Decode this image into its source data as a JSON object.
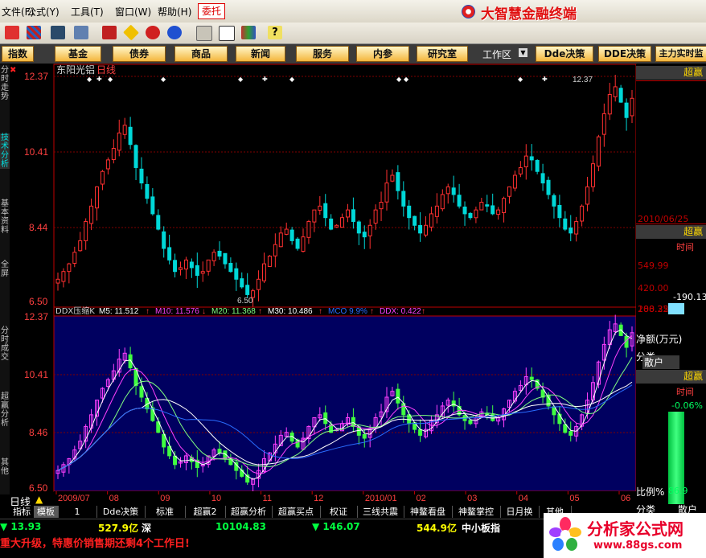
{
  "app": {
    "title": "大智慧金融终端"
  },
  "menu": {
    "items": [
      {
        "label": "文件(F)"
      },
      {
        "label": "公式(Y)"
      },
      {
        "label": "工具(T)"
      },
      {
        "label": "窗口(W)"
      },
      {
        "label": "帮助(H)"
      }
    ],
    "entrust": "委托"
  },
  "toolbar": {
    "icons": [
      "quote-icon",
      "draw-icon",
      "binoculars-icon",
      "tools-icon",
      "flag-icon",
      "diamond-icon",
      "speaker-icon",
      "globe-icon",
      "calculator-icon",
      "window-icon",
      "books-icon",
      "help-icon"
    ]
  },
  "nav": {
    "buttons": [
      "指数",
      "基金",
      "债券",
      "商品",
      "新闻",
      "服务",
      "内参",
      "研究室"
    ],
    "workarea": "工作区",
    "dde_buttons": [
      "Dde决策",
      "DDE决策"
    ],
    "main_monitor": "主力实时监"
  },
  "left_tabs": [
    "分时走势",
    "技术分析",
    "基本资料",
    "全屏",
    "分时成交",
    "超赢分析",
    "其他"
  ],
  "price_chart": {
    "stock_name": "东阳光铝",
    "period": "日线",
    "y_labels": [
      "12.37",
      "10.41",
      "8.44",
      "6.50"
    ],
    "low_annotation": "6.50",
    "high_annotation": "12.37"
  },
  "ddx_chart": {
    "title": "DDX压缩K",
    "indicators": [
      {
        "label": "M5: 11.512",
        "arrow": "↑",
        "color": "#ffffff"
      },
      {
        "label": "M10: 11.576",
        "arrow": "↓",
        "color": "#ff40ff"
      },
      {
        "label": "M20: 11.368",
        "arrow": "↑",
        "color": "#80ff80"
      },
      {
        "label": "M30: 10.486",
        "arrow": "↑",
        "color": "#ffffff"
      },
      {
        "label": "MCO  9.9%",
        "arrow": "↑",
        "color": "#2a6cff"
      },
      {
        "label": "DDX: 0.422",
        "arrow": "↑",
        "color": "#ff40ff"
      }
    ],
    "y_labels": [
      "12.37",
      "10.41",
      "8.46",
      "6.50"
    ]
  },
  "chart_data": {
    "type": "candlestick",
    "title": "东阳光铝 日线",
    "x_labels": [
      "2009/07",
      "08",
      "09",
      "10",
      "11",
      "12",
      "2010/01",
      "02",
      "03",
      "04",
      "05",
      "06"
    ],
    "ylim": [
      6.5,
      12.37
    ],
    "y_ticks": [
      12.37,
      10.41,
      8.44,
      6.5
    ],
    "close_series": [
      7.1,
      7.3,
      7.5,
      7.8,
      8.1,
      8.6,
      9.0,
      9.5,
      9.9,
      10.2,
      10.5,
      10.9,
      11.1,
      10.6,
      10.0,
      9.6,
      9.2,
      8.8,
      8.4,
      7.9,
      7.6,
      7.3,
      7.4,
      7.6,
      7.4,
      7.2,
      7.3,
      7.6,
      7.8,
      7.7,
      7.5,
      7.3,
      7.1,
      6.9,
      6.7,
      6.8,
      7.1,
      7.5,
      7.7,
      8.0,
      8.3,
      8.4,
      8.1,
      7.9,
      8.2,
      8.6,
      8.9,
      9.0,
      8.7,
      8.4,
      8.5,
      8.7,
      8.9,
      8.6,
      8.3,
      8.2,
      8.5,
      8.9,
      9.1,
      9.6,
      9.8,
      9.4,
      9.0,
      8.7,
      8.5,
      8.3,
      8.5,
      8.8,
      9.0,
      9.3,
      9.5,
      9.3,
      9.0,
      8.8,
      8.7,
      8.9,
      9.1,
      9.0,
      8.8,
      8.9,
      9.2,
      9.5,
      9.8,
      10.0,
      10.3,
      10.2,
      9.9,
      9.6,
      9.3,
      9.0,
      8.7,
      8.4,
      8.3,
      8.6,
      9.0,
      9.5,
      10.1,
      10.8,
      11.4,
      11.9,
      12.1,
      11.7,
      11.3,
      11.8
    ]
  },
  "right_panel": {
    "header1": "超赢",
    "date": "2010/06/25",
    "header2": "超赢",
    "time_label1": "时间",
    "scale": [
      "549.99",
      "420.00",
      "280.25"
    ],
    "value_neg": "-190.13",
    "value_pos": "108.32",
    "net_amount": "净额(万元)",
    "classify1": "分类",
    "retail": "散户",
    "header3": "超赢",
    "time_label2": "时间",
    "percent": "-0.06%",
    "ratio_label": "比例%",
    "ratio_value": "86.9",
    "classify2": "分类",
    "retail2": "散户"
  },
  "bottom_tabs": [
    "指标",
    "模板",
    "1",
    "Dde决策",
    "标准",
    "超赢2",
    "超赢分析",
    "超赢买点",
    "权证",
    "三线共震",
    "神鳌看盘",
    "神鳌掌控",
    "日月换",
    "其他"
  ],
  "period_label": "日线",
  "status": {
    "idx1": "13.93",
    "vol1": "527.9亿",
    "mkt": "深",
    "idx2": "10104.83",
    "idx3": "146.07",
    "vol3": "544.9亿",
    "board": "中小板指",
    "ticker": "重大升级，特惠价销售期还剩4个工作日!"
  },
  "watermark": {
    "name": "分析家公式网",
    "url": "www.88gs.com"
  },
  "colors": {
    "up": "#ff3030",
    "down": "#00d8d8",
    "axis": "#c00000",
    "label": "#ff4040",
    "ddx_bg": "#000060"
  }
}
